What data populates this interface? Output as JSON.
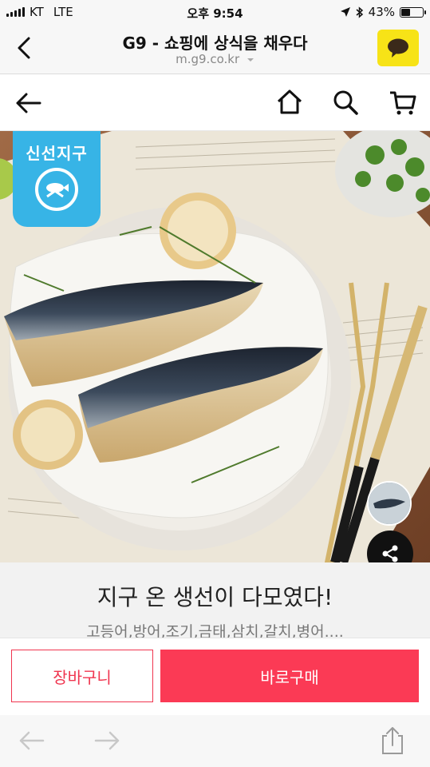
{
  "status_bar": {
    "carrier": "KT",
    "network": "LTE",
    "time": "오후 9:54",
    "battery_percent": "43%",
    "battery_level": 0.43,
    "icons": [
      "location-arrow-icon",
      "bluetooth-icon",
      "battery-icon"
    ]
  },
  "app_header": {
    "title": "G9 - 쇼핑에 상식을 채우다",
    "url": "m.g9.co.kr"
  },
  "badge": {
    "text": "신선지구"
  },
  "product": {
    "name": "지구 온 생선이 다모였다!",
    "subtitle": "고등어,방어,조기,금태,삼치,갈치,병어...."
  },
  "buttons": {
    "cart_label": "장바구니",
    "buy_label": "바로구매"
  },
  "colors": {
    "accent": "#fb3a55",
    "badge": "#37b4e6",
    "kakao": "#f7e317"
  }
}
